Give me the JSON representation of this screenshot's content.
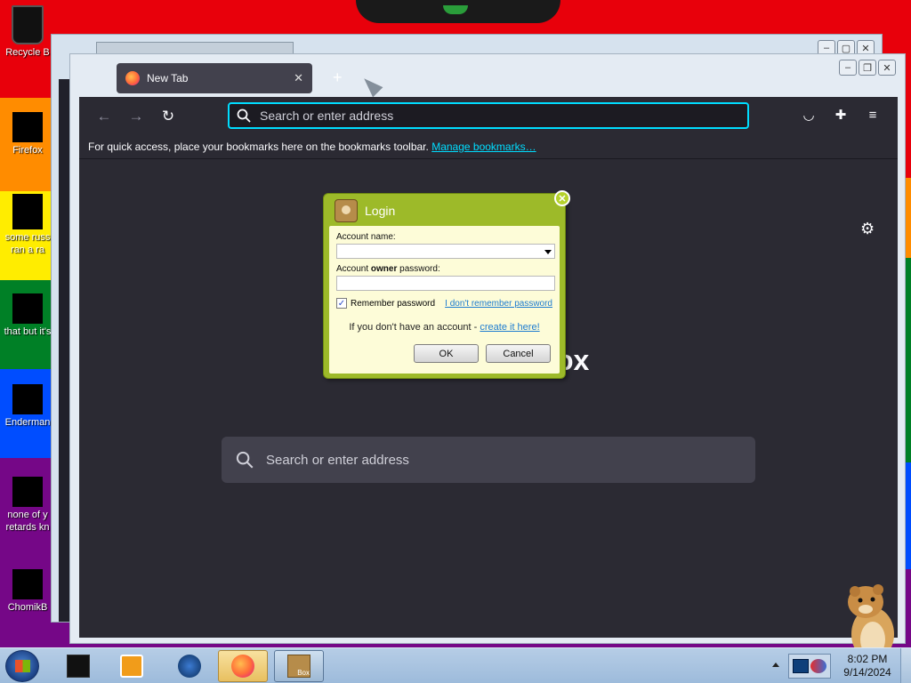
{
  "desktop": {
    "icons": [
      {
        "label": "Recycle B"
      },
      {
        "label": "Firefox"
      },
      {
        "label": "some russ",
        "label2": "ran a ra"
      },
      {
        "label": "that but it's"
      },
      {
        "label": "Enderman"
      },
      {
        "label": "none of y",
        "label2": "retards kn"
      },
      {
        "label": "ChomikB"
      }
    ]
  },
  "browser": {
    "tab_title": "New Tab",
    "new_tab": "+",
    "url_placeholder": "Search or enter address",
    "bookmarks_text": "For quick access, place your bookmarks here on the bookmarks toolbar.",
    "manage_bookmarks": "Manage bookmarks…",
    "wordmark_fragment": "ox",
    "search_placeholder": "Search or enter address"
  },
  "login": {
    "title": "Login",
    "account_name_label": "Account name:",
    "owner_label_pre": "Account ",
    "owner_label_bold": "owner",
    "owner_label_post": " password:",
    "remember_label": "Remember password",
    "forgot_link": "I don't remember password",
    "create_text": "If you don't have an account - ",
    "create_link": "create it here!",
    "ok": "OK",
    "cancel": "Cancel",
    "remember_checked": true
  },
  "taskbar": {
    "time": "8:02 PM",
    "date": "9/14/2024",
    "chomik_label": "Box"
  },
  "colors": {
    "accent": "#00ddff",
    "dialog_green": "#9dba29",
    "dialog_body": "#fdfcd8"
  }
}
